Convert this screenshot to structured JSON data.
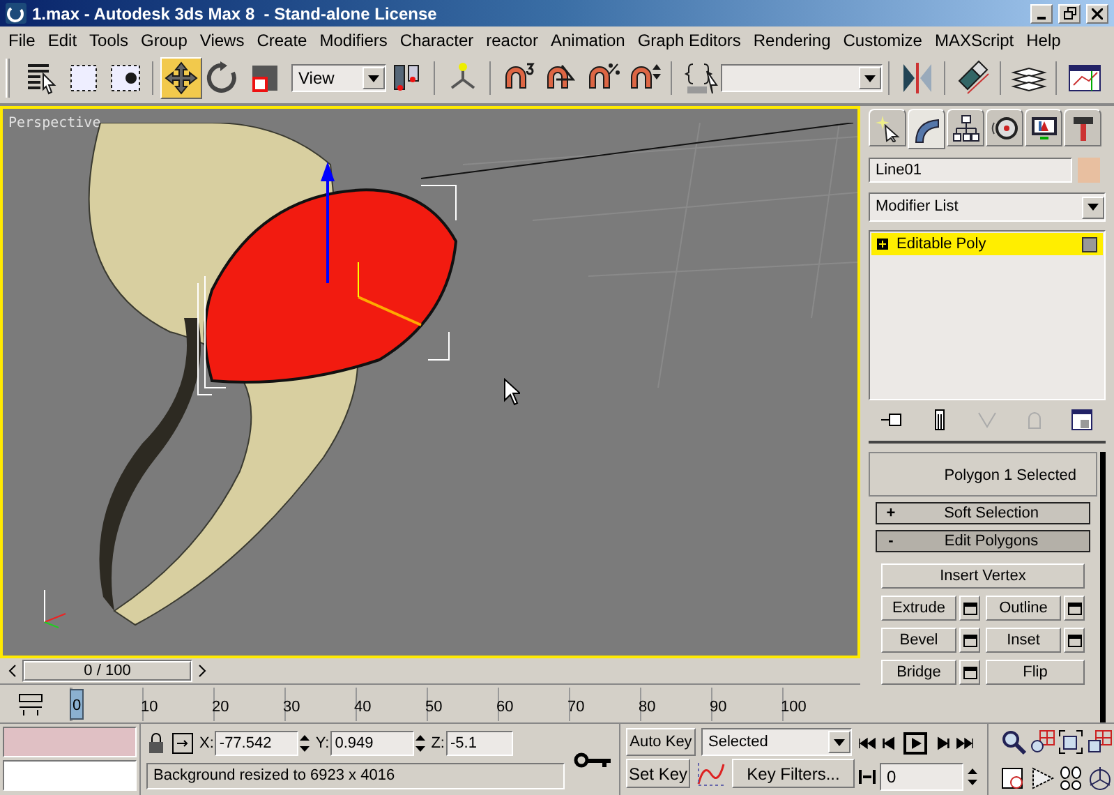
{
  "window": {
    "title": "1.max - Autodesk 3ds Max 8  - Stand-alone License"
  },
  "menu": [
    "File",
    "Edit",
    "Tools",
    "Group",
    "Views",
    "Create",
    "Modifiers",
    "Character",
    "reactor",
    "Animation",
    "Graph Editors",
    "Rendering",
    "Customize",
    "MAXScript",
    "Help"
  ],
  "toolbar": {
    "tools_left": [
      {
        "kind": "select-name",
        "selected": false
      },
      {
        "kind": "region",
        "selected": false
      },
      {
        "kind": "crossing",
        "selected": false
      },
      {
        "kind": "move",
        "selected": true
      },
      {
        "kind": "rotate",
        "selected": false
      },
      {
        "kind": "scale",
        "selected": false
      }
    ],
    "reference_coord": "View",
    "tools_right": [
      {
        "kind": "pivot",
        "selected": false
      },
      {
        "kind": "link",
        "selected": false
      },
      {
        "kind": "snap",
        "selected": false
      },
      {
        "kind": "angle-snap",
        "selected": false
      },
      {
        "kind": "percent-snap",
        "selected": false
      },
      {
        "kind": "spinner-snap",
        "selected": false
      },
      {
        "kind": "named-sets",
        "selected": false
      }
    ],
    "tools_end": [
      {
        "kind": "mirror",
        "selected": false
      },
      {
        "kind": "align",
        "selected": false
      },
      {
        "kind": "layers",
        "selected": false
      },
      {
        "kind": "curve-editor",
        "selected": false
      }
    ]
  },
  "viewport": {
    "label": "Perspective"
  },
  "command_panel": {
    "tabs": [
      {
        "kind": "create",
        "selected": false
      },
      {
        "kind": "modify",
        "selected": true
      },
      {
        "kind": "hierarchy",
        "selected": false
      },
      {
        "kind": "motion",
        "selected": false
      },
      {
        "kind": "display",
        "selected": false
      },
      {
        "kind": "utilities",
        "selected": false
      }
    ],
    "object_name": "Line01",
    "modifier_list": "Modifier List",
    "stack": [
      {
        "label": "Editable Poly",
        "selected": true
      }
    ],
    "status": "Polygon 1 Selected",
    "rollouts": [
      {
        "sign": "+",
        "title": "Soft Selection",
        "expanded": false
      },
      {
        "sign": "-",
        "title": "Edit Polygons",
        "expanded": true
      }
    ],
    "buttons": [
      {
        "label": "Insert Vertex",
        "kind": "wide"
      },
      {
        "label": "Extrude",
        "kind": "with-settings"
      },
      {
        "label": "Outline",
        "kind": "with-settings"
      },
      {
        "label": "Bevel",
        "kind": "with-settings"
      },
      {
        "label": "Inset",
        "kind": "with-settings"
      },
      {
        "label": "Bridge",
        "kind": "with-settings"
      },
      {
        "label": "Flip",
        "kind": "plain"
      }
    ]
  },
  "time_slider": {
    "label": "0 / 100",
    "level": 1,
    "ticks": [
      "0",
      "10",
      "20",
      "30",
      "40",
      "50",
      "60",
      "70",
      "80",
      "90",
      "100"
    ]
  },
  "coords": [
    {
      "label": "X:",
      "value": "-77.542"
    },
    {
      "label": "Y:",
      "value": "0.949"
    },
    {
      "label": "Z:",
      "value": "-5.1"
    }
  ],
  "status_bar": "Background resized to 6923 x 4016",
  "auto_key": "Auto Key",
  "key_mode": "Selected",
  "set_key": "Set Key",
  "key_filters": "Key Filters...",
  "frame": "0"
}
